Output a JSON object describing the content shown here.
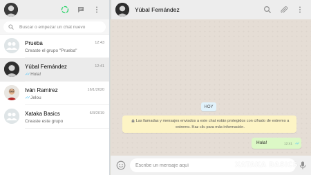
{
  "sidebar": {
    "header": {
      "icons": [
        "status-icon",
        "new-chat-icon",
        "menu-icon"
      ]
    },
    "search": {
      "placeholder": "Buscar o empezar un chat nuevo"
    },
    "chats": [
      {
        "name": "Prueba",
        "time": "12:43",
        "preview": "Creaste el grupo \"Prueba\"",
        "ticks": false,
        "avatar": "group-avatar"
      },
      {
        "name": "Yúbal Fernández",
        "time": "12:41",
        "preview": "Hola!",
        "ticks": true,
        "avatar": "person-avatar",
        "active": true
      },
      {
        "name": "Iván Ramírez",
        "time": "16/1/2020",
        "preview": "Jelou",
        "ticks": true,
        "avatar": "person-avatar"
      },
      {
        "name": "Xataka Basics",
        "time": "6/3/2019",
        "preview": "Creaste este grupo",
        "ticks": false,
        "avatar": "group-avatar"
      }
    ]
  },
  "conversation": {
    "contact_name": "Yúbal Fernández",
    "header_icons": [
      "search-icon",
      "attach-icon",
      "menu-icon"
    ],
    "date_label": "HOY",
    "encryption_notice": "Las llamadas y mensajes enviados a este chat están protegidos con cifrado de extremo a extremo. Haz clic para más información.",
    "messages": [
      {
        "text": "Hola!",
        "time": "12:41",
        "direction": "out",
        "ticks": "✓✓"
      }
    ],
    "composer_placeholder": "Escribe un mensaje aquí"
  },
  "watermark": "XATAKA BASICS",
  "colors": {
    "header_bg": "#ededed",
    "chat_bg": "#e5ddd5",
    "outgoing_bubble": "#dcf8c6",
    "notice_bg": "#fdf4c5",
    "date_pill": "#e1f2fb",
    "read_ticks": "#4fc3f7",
    "status_ring": "#25d366"
  }
}
